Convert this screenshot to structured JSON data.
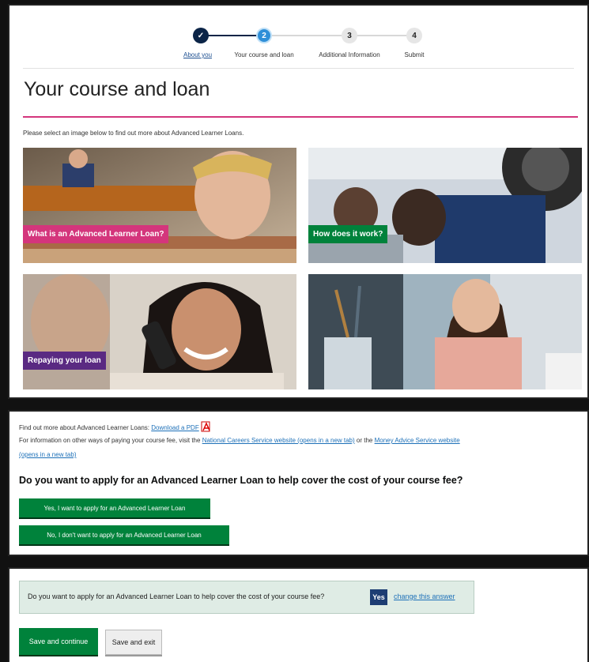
{
  "stepper": {
    "steps": [
      {
        "label": "About you",
        "number": "✓",
        "state": "done"
      },
      {
        "label": "Your course and loan",
        "number": "2",
        "state": "current"
      },
      {
        "label": "Additional Information",
        "number": "3",
        "state": "todo"
      },
      {
        "label": "Submit",
        "number": "4",
        "state": "todo"
      }
    ]
  },
  "page": {
    "title": "Your course and loan",
    "intro": "Please select an image below to find out more about Advanced Learner Loans."
  },
  "tiles": [
    {
      "label": "What is an Advanced Learner Loan?",
      "color": "#d4357c"
    },
    {
      "label": "How does it work?",
      "color": "#00823b"
    },
    {
      "label": "Repaying your loan",
      "color": "#5a2a82"
    },
    {
      "label": "",
      "color": ""
    }
  ],
  "info": {
    "download_prefix": "Find out more about Advanced Learner Loans:",
    "download_link": "Download a PDF",
    "other_prefix": "For information on other ways of paying your course fee, visit the",
    "ncs_link": "National Careers Service website (opens in a new tab)",
    "or": "or the",
    "mas_link": "Money Advice Service website",
    "mas_link_2": "(opens in a new tab)",
    "question": "Do you want to apply for an Advanced Learner Loan to help cover the cost of your course fee?",
    "yes_button": "Yes, I want to apply for an Advanced Learner Loan",
    "no_button": "No, I don't want to apply for an Advanced Learner Loan"
  },
  "summary": {
    "question": "Do you want to apply for an Advanced Learner Loan to help cover the cost of your course fee?",
    "answer": "Yes",
    "change_link": "change this answer",
    "save_continue": "Save and continue",
    "save_exit": "Save and exit"
  },
  "colors": {
    "govuk_green": "#00823b",
    "accent_pink": "#d4357c",
    "accent_purple": "#5a2a82",
    "step_done": "#0b2447",
    "step_current": "#2f8fd8"
  }
}
